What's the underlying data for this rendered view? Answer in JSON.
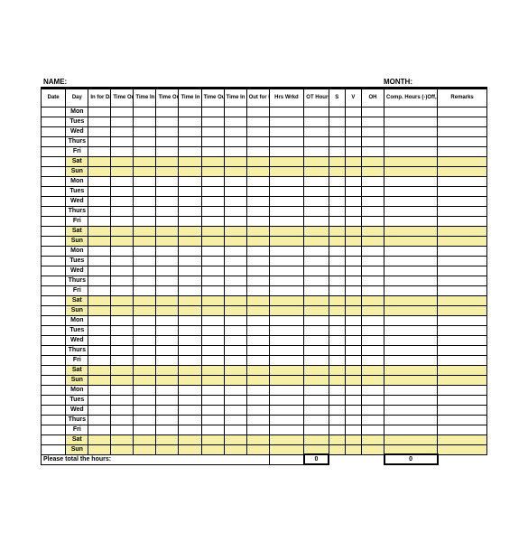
{
  "labels": {
    "name": "NAME:",
    "month": "MONTH:"
  },
  "columns": [
    "Date",
    "Day",
    "In for Day",
    "Time Out",
    "Time In",
    "Time Out",
    "Time In",
    "Time Out",
    "Time In",
    "Out for Day",
    "Hrs Wrkd",
    "OT Hours",
    "S",
    "V",
    "OH",
    "Comp. Hours (-)Off, (+)Worked",
    "Remarks"
  ],
  "rows": [
    {
      "day": "Mon",
      "weekend": false
    },
    {
      "day": "Tues",
      "weekend": false
    },
    {
      "day": "Wed",
      "weekend": false
    },
    {
      "day": "Thurs",
      "weekend": false
    },
    {
      "day": "Fri",
      "weekend": false
    },
    {
      "day": "Sat",
      "weekend": true
    },
    {
      "day": "Sun",
      "weekend": true
    },
    {
      "day": "Mon",
      "weekend": false
    },
    {
      "day": "Tues",
      "weekend": false
    },
    {
      "day": "Wed",
      "weekend": false
    },
    {
      "day": "Thurs",
      "weekend": false
    },
    {
      "day": "Fri",
      "weekend": false
    },
    {
      "day": "Sat",
      "weekend": true
    },
    {
      "day": "Sun",
      "weekend": true
    },
    {
      "day": "Mon",
      "weekend": false
    },
    {
      "day": "Tues",
      "weekend": false
    },
    {
      "day": "Wed",
      "weekend": false
    },
    {
      "day": "Thurs",
      "weekend": false
    },
    {
      "day": "Fri",
      "weekend": false
    },
    {
      "day": "Sat",
      "weekend": true
    },
    {
      "day": "Sun",
      "weekend": true
    },
    {
      "day": "Mon",
      "weekend": false
    },
    {
      "day": "Tues",
      "weekend": false
    },
    {
      "day": "Wed",
      "weekend": false
    },
    {
      "day": "Thurs",
      "weekend": false
    },
    {
      "day": "Fri",
      "weekend": false
    },
    {
      "day": "Sat",
      "weekend": true
    },
    {
      "day": "Sun",
      "weekend": true
    },
    {
      "day": "Mon",
      "weekend": false
    },
    {
      "day": "Tues",
      "weekend": false
    },
    {
      "day": "Wed",
      "weekend": false
    },
    {
      "day": "Thurs",
      "weekend": false
    },
    {
      "day": "Fri",
      "weekend": false
    },
    {
      "day": "Sat",
      "weekend": true
    },
    {
      "day": "Sun",
      "weekend": true
    }
  ],
  "footer": {
    "label": "Please total the hours:",
    "total1": "0",
    "total2": "0"
  }
}
